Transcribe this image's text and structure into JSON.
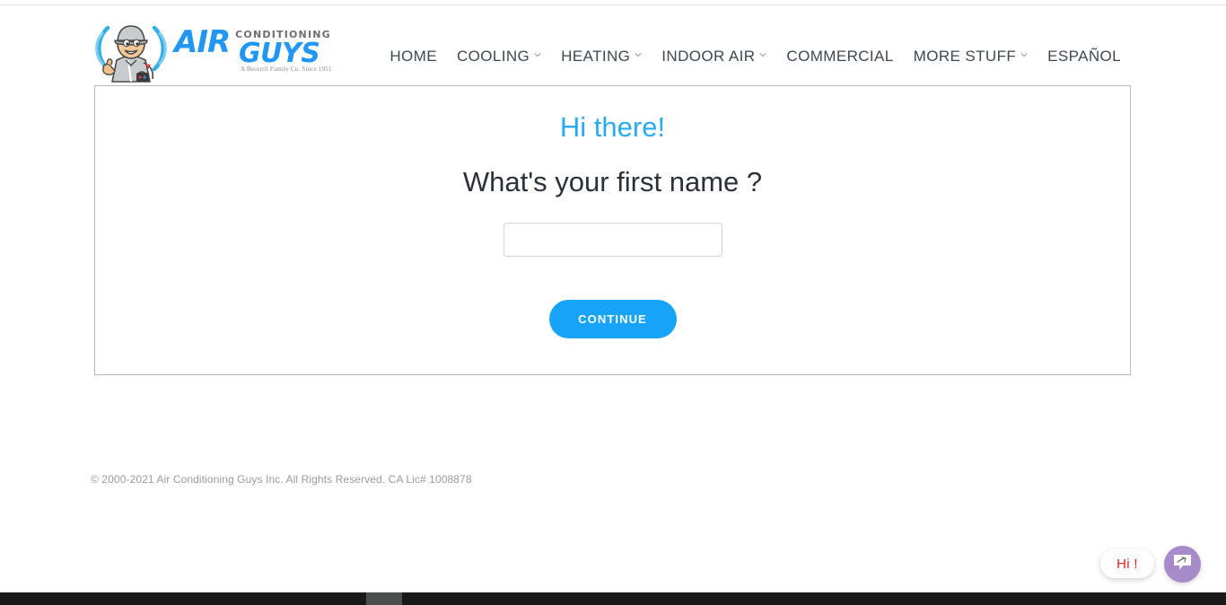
{
  "header": {
    "logo": {
      "icon_name": "technician-mascot-icon",
      "word_air": "AIR",
      "word_conditioning": "CONDITIONING",
      "word_guys": "GUYS",
      "tagline": "A Becerril Family Co. Since 1951"
    },
    "nav": [
      {
        "label": "HOME",
        "has_dropdown": false
      },
      {
        "label": "COOLING",
        "has_dropdown": true
      },
      {
        "label": "HEATING",
        "has_dropdown": true
      },
      {
        "label": "INDOOR AIR",
        "has_dropdown": true
      },
      {
        "label": "COMMERCIAL",
        "has_dropdown": false
      },
      {
        "label": "MORE STUFF",
        "has_dropdown": true
      },
      {
        "label": "ESPAÑOL",
        "has_dropdown": false
      }
    ]
  },
  "main": {
    "greeting": "Hi there!",
    "question": "What's your first name ?",
    "name_input": {
      "value": "",
      "placeholder": ""
    },
    "continue_label": "CONTINUE"
  },
  "footer": {
    "copyright": "© 2000-2021 Air Conditioning Guys Inc. All Rights Reserved. CA Lic# 1008878"
  },
  "chat": {
    "greeting_label": "Hi !",
    "button_icon": "chat-bubble-arrow-icon"
  },
  "colors": {
    "accent_blue": "#29abf2",
    "button_blue": "#17a3f7",
    "logo_blue": "#2196f3",
    "chat_purple": "#a78bc9",
    "chat_text_red": "#e02020",
    "heading_dark": "#2b3138",
    "nav_text": "#3d4852",
    "footer_gray": "#9a9a9a"
  },
  "scrollbar": {
    "orientation": "horizontal"
  }
}
